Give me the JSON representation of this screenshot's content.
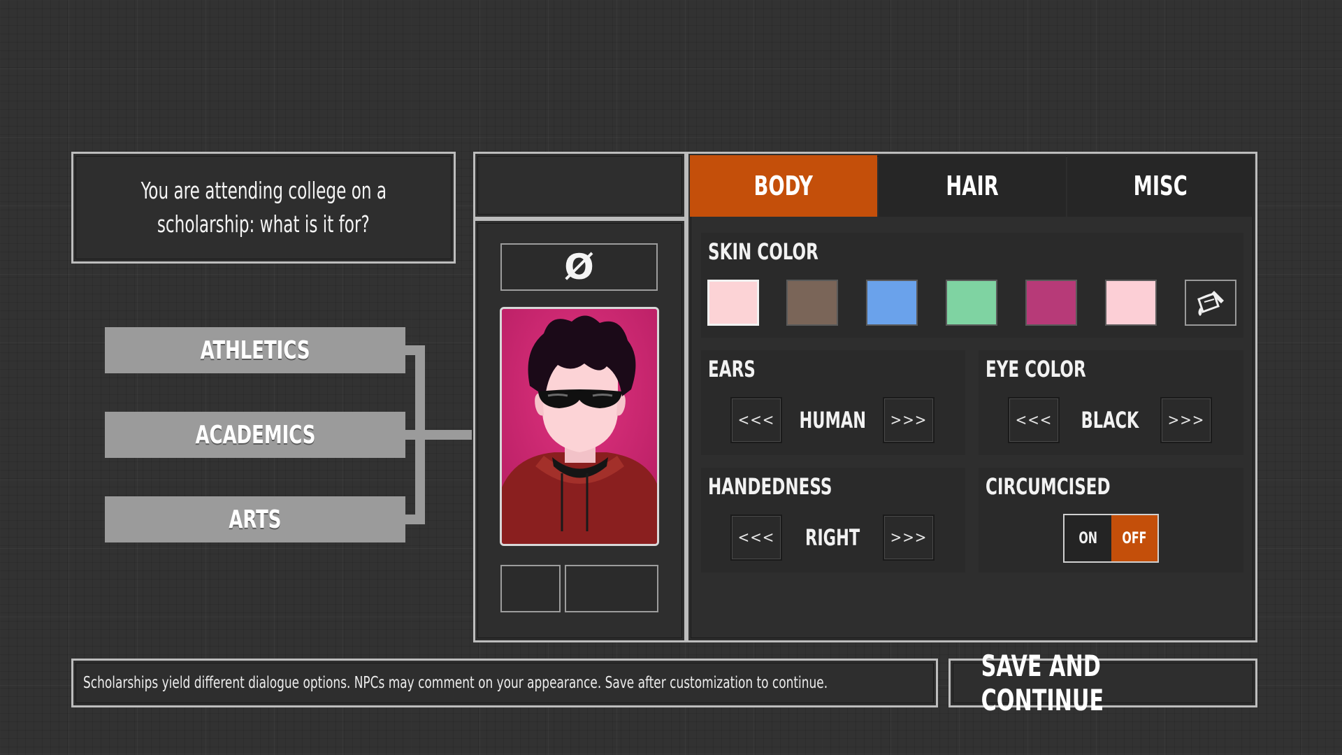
{
  "prompt": {
    "line1": "You are attending college on a",
    "line2": "scholarship: what is it for?"
  },
  "scholarships": [
    "ATHLETICS",
    "ACADEMICS",
    "ARTS"
  ],
  "portrait": {
    "top_symbol": "Ø",
    "background_color": "#d42a78",
    "hoodie_color": "#8a1f1f",
    "skin_color": "#fcd3d6",
    "hair_color": "#1b0a18"
  },
  "tabs": [
    {
      "label": "BODY",
      "active": true
    },
    {
      "label": "HAIR",
      "active": false
    },
    {
      "label": "MISC",
      "active": false
    }
  ],
  "skin_color": {
    "title": "SKIN COLOR",
    "swatches": [
      "#fcd3d6",
      "#7a6558",
      "#6aa2eb",
      "#7fd3a2",
      "#b73a78",
      "#fccfd6"
    ],
    "selected_index": 0,
    "custom_icon": "paint-bucket-icon"
  },
  "ears": {
    "title": "EARS",
    "value": "HUMAN"
  },
  "eye_color": {
    "title": "EYE COLOR",
    "value": "BLACK"
  },
  "handedness": {
    "title": "HANDEDNESS",
    "value": "RIGHT"
  },
  "circumcised": {
    "title": "CIRCUMCISED",
    "on_label": "ON",
    "off_label": "OFF",
    "selected": "OFF"
  },
  "arrows": {
    "prev": "<<<",
    "next": ">>>"
  },
  "info_text": "Scholarships yield different dialogue options. NPCs may comment on your appearance. Save after customization to continue.",
  "save_button": "SAVE AND CONTINUE",
  "colors": {
    "accent": "#c44f0a",
    "panel_border": "#bdbdbd",
    "button_gray": "#9b9b9b"
  }
}
